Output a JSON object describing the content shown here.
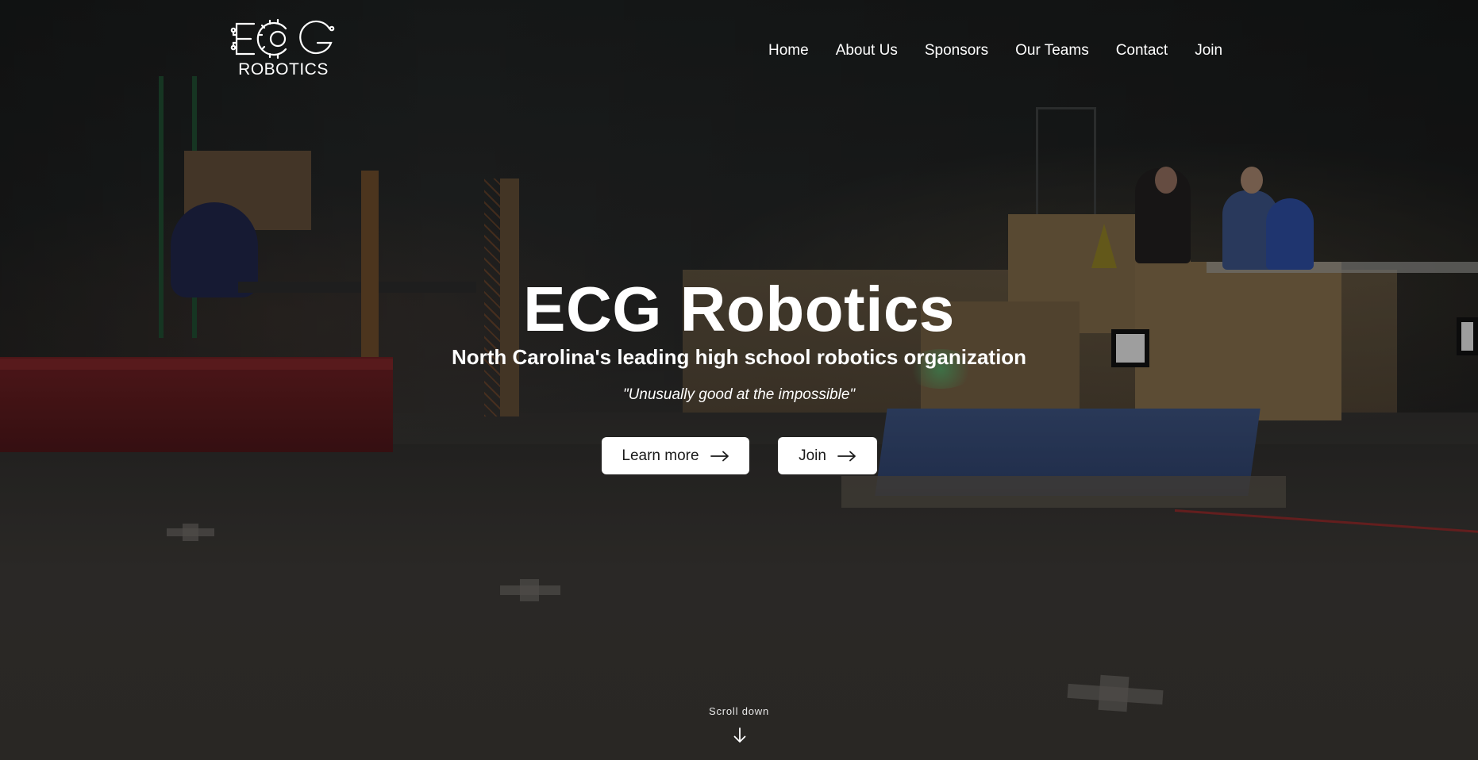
{
  "site": {
    "logo_text_top": "ECG",
    "logo_text_bottom": "ROBOTICS"
  },
  "nav": {
    "items": [
      {
        "label": "Home"
      },
      {
        "label": "About Us"
      },
      {
        "label": "Sponsors"
      },
      {
        "label": "Our Teams"
      },
      {
        "label": "Contact"
      },
      {
        "label": "Join"
      }
    ]
  },
  "hero": {
    "title": "ECG Robotics",
    "subtitle": "North Carolina's leading high school robotics organization",
    "tagline": "\"Unusually good at the impossible\"",
    "buttons": {
      "learn_more": "Learn more",
      "join": "Join"
    },
    "scroll_label": "Scroll down"
  },
  "icons": {
    "logo": "ecg-robotics-logo",
    "button_arrow": "arrow-right-icon",
    "scroll": "arrow-down-icon"
  },
  "colors": {
    "text": "#ffffff",
    "button_bg": "#ffffff",
    "button_text": "#1a1a1a"
  }
}
